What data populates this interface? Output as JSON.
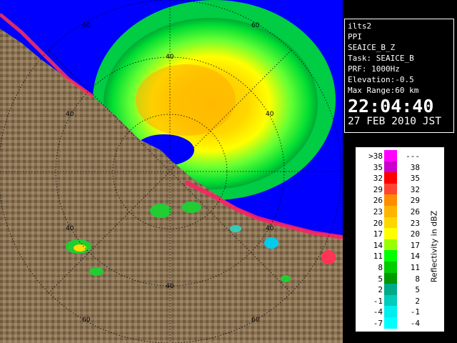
{
  "info": {
    "lines": [
      "ilts2",
      "PPI",
      "SEAICE_B_Z",
      "Task: SEAICE_B",
      "PRF: 1000Hz",
      "Elevation:-0.5",
      "Max Range:60 km"
    ],
    "time": "22:04:40",
    "date": "27 FEB 2010 JST"
  },
  "legend": {
    "unit": "Reflectivity in dBZ",
    "rows": [
      {
        "lo": ">38",
        "hi": "---",
        "color": "#ff00ff"
      },
      {
        "lo": "35",
        "hi": "38",
        "color": "#cc00cc"
      },
      {
        "lo": "32",
        "hi": "35",
        "color": "#ff0000"
      },
      {
        "lo": "29",
        "hi": "32",
        "color": "#ff4433"
      },
      {
        "lo": "26",
        "hi": "29",
        "color": "#ff8c00"
      },
      {
        "lo": "23",
        "hi": "26",
        "color": "#ffb400"
      },
      {
        "lo": "20",
        "hi": "23",
        "color": "#ffd700"
      },
      {
        "lo": "17",
        "hi": "20",
        "color": "#ffff00"
      },
      {
        "lo": "14",
        "hi": "17",
        "color": "#99ff00"
      },
      {
        "lo": "11",
        "hi": "14",
        "color": "#00ff00"
      },
      {
        "lo": "8",
        "hi": "11",
        "color": "#00cc00"
      },
      {
        "lo": "5",
        "hi": "8",
        "color": "#009900"
      },
      {
        "lo": "2",
        "hi": "5",
        "color": "#00aa88"
      },
      {
        "lo": "-1",
        "hi": "2",
        "color": "#00ccbb"
      },
      {
        "lo": "-4",
        "hi": "-1",
        "color": "#00eeee"
      },
      {
        "lo": "-7",
        "hi": "-4",
        "color": "#00ffff"
      }
    ]
  },
  "map": {
    "range_labels": [
      "40",
      "40",
      "40",
      "40",
      "40",
      "40",
      "60",
      "60",
      "60",
      "60"
    ],
    "colors": {
      "sea": "#0000ff",
      "land": "#8b7355",
      "rings": "#000000"
    }
  }
}
